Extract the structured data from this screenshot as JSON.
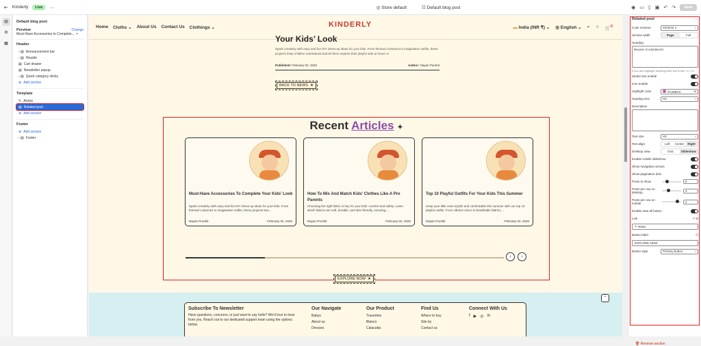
{
  "topbar": {
    "app_name": "Kinderly",
    "status": "Live",
    "more": "…",
    "store": "Store default",
    "template": "Default blog post",
    "save": "Save"
  },
  "left": {
    "title": "Default blog post",
    "preview_label": "Preview",
    "change": "Change",
    "preview_value": "Must-Have Accessories to Complete...",
    "header_section": "Header",
    "header_items": [
      "Announcement bar",
      "Header",
      "Cart drawer",
      "Newsletter popup",
      "Quick category sticky"
    ],
    "add_section": "Add section",
    "template_section": "Template",
    "template_items": [
      "Article",
      "Related post"
    ],
    "footer_section": "Footer",
    "footer_items": [
      "Footer"
    ]
  },
  "site": {
    "nav": [
      "Cloths",
      "About Us",
      "Contact Us",
      "Clothings"
    ],
    "logo": "KINDERLY",
    "country": "India (INR ₹)",
    "language": "English",
    "cart_count": "0"
  },
  "article": {
    "title": "Your Kids’ Look",
    "desc": "Spark creativity with easy and fun DIY dress-up ideas for your kids. From themed costumes to imaginative outfits, these projects keep children entertained and let them explore their playful side at home or",
    "published_label": "Published:",
    "published": "February 02, 2026",
    "author_label": "Author:",
    "author": "Nayan Purohit",
    "back": "BACK TO NEWS"
  },
  "recent": {
    "title_a": "Recent",
    "title_b": "Articles",
    "explore": "EXPLORE NOW",
    "slider_progress": 0.25,
    "cards": [
      {
        "title": "Must-Have Accessories To Complete Your Kids’ Look",
        "desc": "Spark creativity with easy and fun DIY dress-up ideas for your kids. From themed costumes to imaginative outfits, these projects kee...",
        "author": "Nayan Purohit",
        "date": "February 02, 2026"
      },
      {
        "title": "How To Mix And Match Kids’ Clothes Like A Pro Parents",
        "desc": "Choosing the right fabric is key for your kids’ comfort and safety. Learn which fabrics are soft, durable, and skin-friendly, ensuring...",
        "author": "Nayan Purohit",
        "date": "February 02, 2026"
      },
      {
        "title": "Top 10 Playful Outfits For Your Kids This Summer",
        "desc": "Keep your little ones stylish and comfortable this summer with our top 10 playful outfits. From vibrant colors to breathable fabrics, ...",
        "author": "Nayan Purohit",
        "date": "February 02, 2026"
      }
    ]
  },
  "footer": {
    "subscribe_title": "Subscribe To Newsletter",
    "subscribe_text": "Have questions, concerns, or just want to say hello? We'd love to hear from you. Reach out to our dedicated support team using the options below.",
    "navigate": "Our Navigate",
    "navigate_items": [
      "Babys",
      "About us",
      "Dresses"
    ],
    "product": "Our Product",
    "product_items": [
      "Travertine",
      "Blanco",
      "Calacatta"
    ],
    "find": "Find Us",
    "find_items": [
      "Where to buy",
      "Site by",
      "Contact us"
    ],
    "connect": "Connect With Us"
  },
  "right": {
    "title": "Related post",
    "more": "…",
    "color_scheme_label": "Color scheme",
    "color_scheme": "Scheme 1",
    "section_width_label": "Section width",
    "section_width_options": [
      "Page",
      "Full"
    ],
    "heading_label": "Heading",
    "heading_value": "Recent <i>Articles</i>",
    "heading_help": "If you add highlight heading write text under <i> </i>",
    "stroke_label": "Stroke text enable",
    "icon_label": "Icon enable",
    "highlight_label": "Highlight color",
    "highlight_value": "#C25BAC",
    "highlight_color": "#c25bac",
    "heading_size_label": "Heading size",
    "heading_size": "H4",
    "description_label": "Description",
    "text_size_label": "Text size",
    "text_size": "H3",
    "text_align_label": "Text align",
    "text_align_options": [
      "Left",
      "Center",
      "Right"
    ],
    "desktop_view_label": "Desktop view",
    "desktop_view_options": [
      "Grid",
      "Slideshow"
    ],
    "mobile_slideshow_label": "Enable mobile slideshow",
    "nav_arrows_label": "Show navigation arrows",
    "pagination_label": "Show pagination dots",
    "posts_label": "Posts to show",
    "posts": "6",
    "row_desktop_label": "Posts per row on desktop",
    "row_desktop": "3",
    "row_mobile_label": "Posts per row on mobile",
    "row_mobile": "2",
    "view_all_label": "Enable view all button",
    "link_label": "Link",
    "link_value": "News",
    "button_label_label": "Button label",
    "button_label": "EXPLORE NOW",
    "button_style_label": "Button style",
    "button_style": "Primary button",
    "remove": "Remove section"
  }
}
